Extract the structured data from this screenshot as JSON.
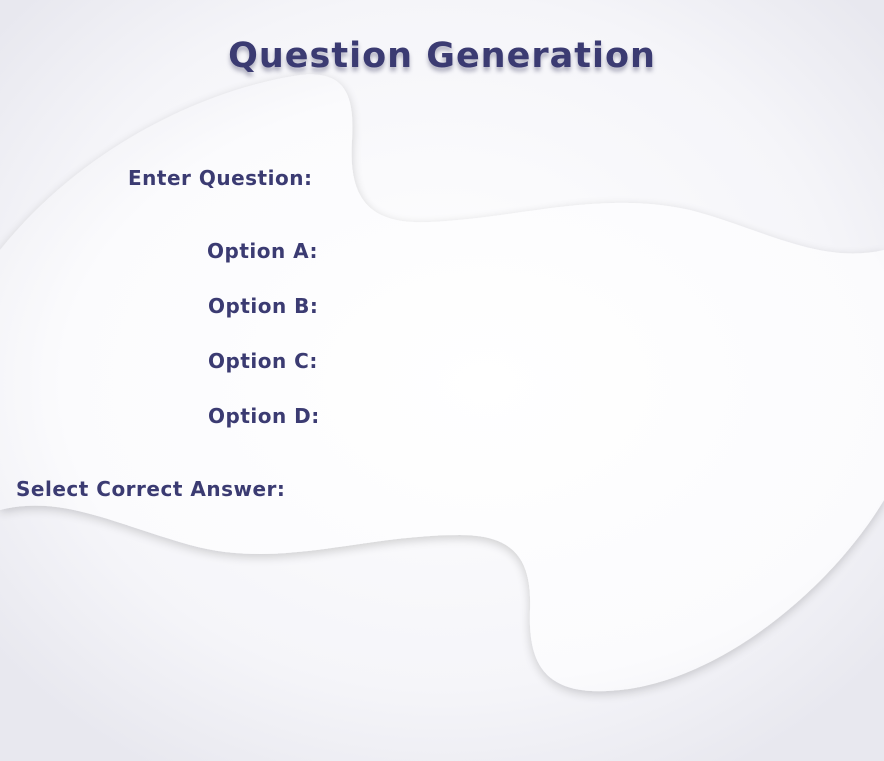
{
  "page": {
    "title": "Question Generation"
  },
  "form": {
    "question_label": "Enter Question:",
    "option_a_label": "Option A:",
    "option_b_label": "Option B:",
    "option_c_label": "Option C:",
    "option_d_label": "Option D:",
    "correct_answer_label": "Select Correct Answer:"
  },
  "colors": {
    "text": "#3b3b72",
    "background": "#f2f2f6",
    "panel": "#ffffff"
  }
}
